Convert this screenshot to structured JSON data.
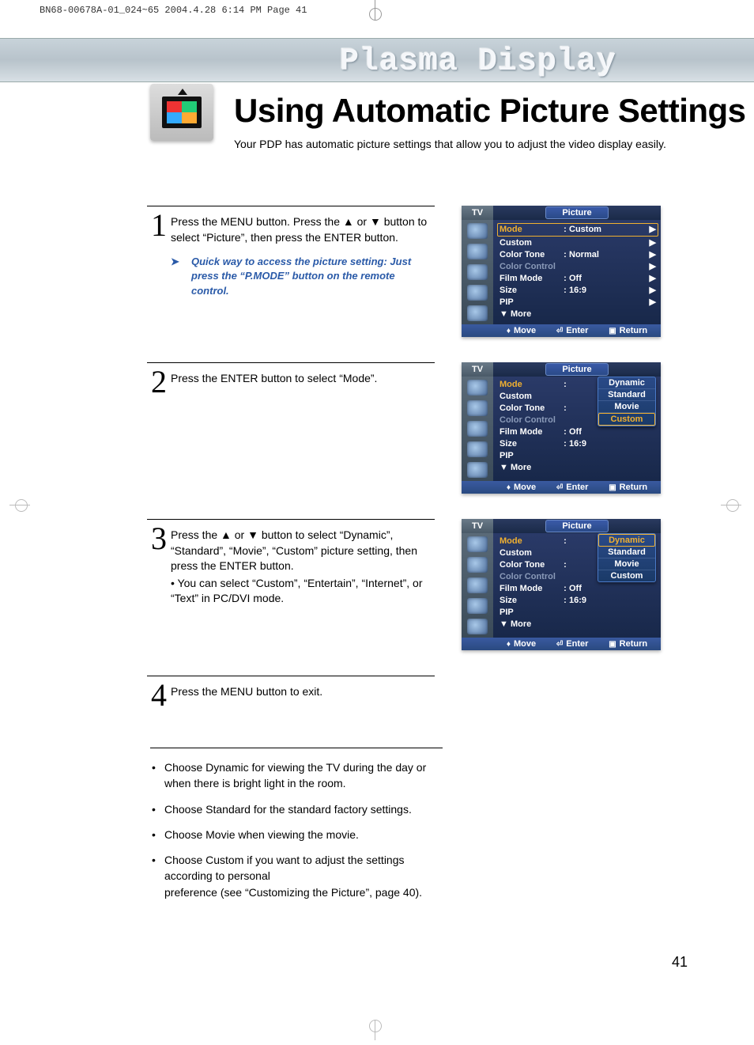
{
  "print_header": "BN68-00678A-01_024~65  2004.4.28  6:14 PM  Page 41",
  "banner_title": "Plasma Display",
  "page_title": "Using Automatic Picture Settings",
  "subtitle": "Your PDP has automatic picture settings that allow you to adjust the video display easily.",
  "page_num": "41",
  "steps": [
    {
      "num": "1",
      "text": "Press the MENU button. Press the ▲ or ▼ button to select “Picture”, then press the ENTER button.",
      "tip": "Quick way to access the picture setting: Just press the “P.MODE” button on the remote control."
    },
    {
      "num": "2",
      "text": "Press the ENTER button to select “Mode”."
    },
    {
      "num": "3",
      "text": "Press the ▲ or ▼ button to select “Dynamic”, “Standard”, “Movie”, “Custom” picture setting, then press the ENTER button.",
      "extra": "• You can select “Custom”, “Entertain”, “Internet”, or “Text” in PC/DVI mode."
    },
    {
      "num": "4",
      "text": "Press the MENU button to exit."
    }
  ],
  "bullets": [
    "Choose Dynamic for viewing the TV during the day or when there is bright light in the room.",
    "Choose Standard for the standard factory settings.",
    "Choose Movie when viewing the movie.",
    "Choose Custom if you want to adjust the settings according to personal\npreference (see “Customizing the Picture”, page 40)."
  ],
  "osd": {
    "tv": "TV",
    "title": "Picture",
    "rows": {
      "mode": "Mode",
      "custom": "Custom",
      "color_tone": "Color Tone",
      "color_control": "Color Control",
      "film_mode": "Film Mode",
      "size": "Size",
      "pip": "PIP",
      "more": "▼ More"
    },
    "values": {
      "mode": "Custom",
      "color_tone": "Normal",
      "film_mode": "Off",
      "size": "16:9"
    },
    "footer": {
      "move": "Move",
      "enter": "Enter",
      "return": "Return"
    },
    "popup": [
      "Dynamic",
      "Standard",
      "Movie",
      "Custom"
    ]
  }
}
